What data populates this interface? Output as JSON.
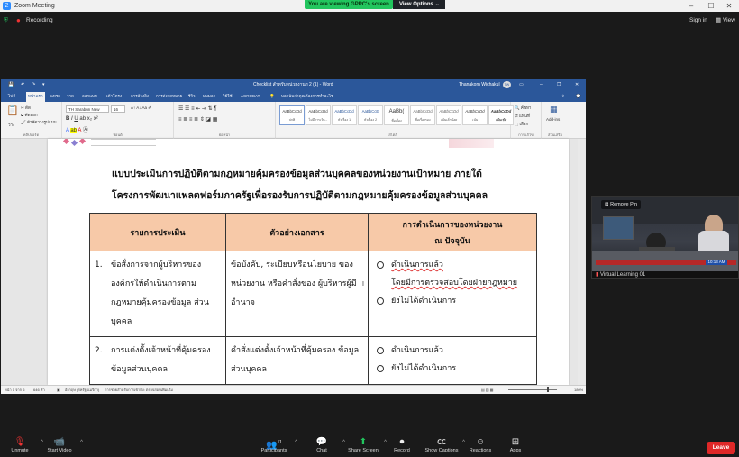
{
  "zoom": {
    "app_title": "Zoom Meeting",
    "share_banner": "You are viewing GPPC's screen",
    "view_options": "View Options",
    "recording": "Recording",
    "sign_in": "Sign in",
    "view": "View"
  },
  "word": {
    "doc_title": "Checklist สำหรับหน่วยงานฯ 2 (1)  -  Word",
    "user": "Thanakorn Wichakul",
    "user_initials": "TW",
    "tabs": [
      "ไฟล์",
      "หน้าแรก",
      "แทรก",
      "วาด",
      "ออกแบบ",
      "เค้าโครง",
      "การอ้างอิง",
      "การส่งจดหมาย",
      "รีวิว",
      "มุมมอง",
      "วิธีใช้",
      "ACROBAT",
      "บอกฉันว่าคุณต้องการทำอะไร"
    ],
    "active_tab": "หน้าแรก",
    "font_name": "TH Sarabun New",
    "font_size": "16",
    "ribbon_groups": [
      "คลิปบอร์ด",
      "ฟอนต์",
      "ย่อหน้า",
      "สไตล์",
      "การแก้ไข",
      "ส่วนเสริม"
    ],
    "clipboard_items": [
      "ตัด",
      "คัดลอก",
      "ตัวคัดวางรูปแบบ"
    ],
    "paste": "วาง",
    "styles": [
      {
        "sample": "AaBbCcDd",
        "name": "ปกติ"
      },
      {
        "sample": "AaBbCcDd",
        "name": "ไม่มีการเว้น..."
      },
      {
        "sample": "AaBbCcDd",
        "name": "หัวเรื่อง 1"
      },
      {
        "sample": "AaBbCcE",
        "name": "หัวเรื่อง 2"
      },
      {
        "sample": "AaBb(",
        "name": "ชื่อเรื่อง"
      },
      {
        "sample": "AaBbCcDd",
        "name": "ชื่อเรื่องรอง"
      },
      {
        "sample": "AaBbCcDd",
        "name": "เน้นเล็กน้อย"
      },
      {
        "sample": "AaBbCcDd",
        "name": "เน้น"
      },
      {
        "sample": "AaBbCcDd",
        "name": "เน้นเข้ม"
      }
    ],
    "editing": [
      "ค้นหา",
      "แทนที่",
      "เลือก"
    ],
    "addins": "Add-ins",
    "status_left": "หน้า 1 จาก 6",
    "status_words": "646 คำ",
    "status_lang": "อังกฤษ (สหรัฐอเมริกา)",
    "status_access": "การช่วยสำหรับการเข้าถึง: ตรวจสอบเพิ่มเติม",
    "zoom_pct": "180%"
  },
  "document": {
    "title_line1": "แบบประเมินการปฏิบัติตามกฎหมายคุ้มครองข้อมูลส่วนบุคคลของหน่วยงานเป้าหมาย ภายใต้",
    "title_line2": "โครงการพัฒนาแพลตฟอร์มภาครัฐเพื่อรองรับการปฏิบัติตามกฎหมายคุ้มครองข้อมูลส่วนบุคคล",
    "headers": [
      "รายการประเมิน",
      "ตัวอย่างเอกสาร",
      "การดำเนินการของหน่วยงาน",
      "ณ ปัจจุบัน"
    ],
    "rows": [
      {
        "num": "1.",
        "item": "ข้อสั่งการจากผู้บริหารของ องค์กรให้ดำเนินการตาม กฎหมายคุ้มครองข้อมูล ส่วนบุคคล",
        "example": "ข้อบังคับ, ระเบียบหรือนโยบาย ของหน่วยงาน หรือคำสั่งของ ผู้บริหารผู้มีอำนาจ",
        "opt1": "ดำเนินการแล้ว",
        "opt1b": "โดยมีการตรวจสอบโดยฝ่ายกฎหมาย",
        "opt2": "ยังไม่ได้ดำเนินการ"
      },
      {
        "num": "2.",
        "item": "การแต่งตั้งเจ้าหน้าที่คุ้มครอง ข้อมูลส่วนบุคคล",
        "example": "คำสั่งแต่งตั้งเจ้าหน้าที่คุ้มครอง ข้อมูลส่วนบุคคล",
        "opt1": "ดำเนินการแล้ว",
        "opt2": "ยังไม่ได้ดำเนินการ"
      }
    ]
  },
  "video": {
    "remove_pin": "Remove Pin",
    "name": "Virtual Learning 01",
    "clock": "10:13 AM"
  },
  "toolbar": {
    "unmute": "Unmute",
    "start_video": "Start Video",
    "participants": "Participants",
    "participants_count": "11",
    "chat": "Chat",
    "share_screen": "Share Screen",
    "record": "Record",
    "show_captions": "Show Captions",
    "reactions": "Reactions",
    "apps": "Apps",
    "leave": "Leave"
  },
  "colors": {
    "zoom_green": "#22c55e",
    "word_blue": "#2b579a",
    "table_header": "#f7c9a8",
    "leave_red": "#e02828"
  }
}
